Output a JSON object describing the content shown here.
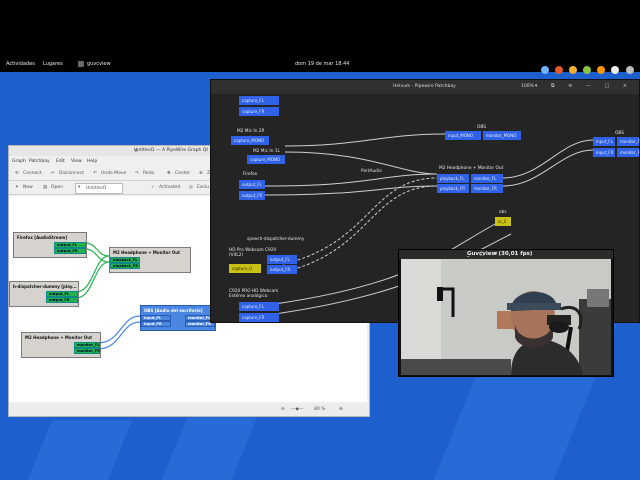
{
  "topbar": {
    "activities": "Actividades",
    "places": "Lugares",
    "app_name": "guvcview",
    "datetime": "dom 19 de mar  18:44"
  },
  "colors": {
    "wallpaper": "#1d5fcc",
    "helvum_port_blue": "#2f62e6",
    "helvum_port_yellow": "#c9c214",
    "qt_port_green": "#22b14c",
    "qt_port_blue": "#4b87e0"
  },
  "left_window": {
    "title": "Untitled1 — A PipeWire Graph Qt",
    "close": "×",
    "menu": [
      "Graph",
      "Patchbay",
      "Edit",
      "View",
      "Help"
    ],
    "toolbar": [
      "Connect",
      "Disconnect",
      "Undo Move",
      "Redo",
      "Center",
      "Zoom"
    ],
    "toolbar2": [
      "New",
      "Open"
    ],
    "combo_value": "Untitled1",
    "toolbar2_right": [
      "Activated",
      "Exclu"
    ],
    "zoom": "80 %",
    "nodes": {
      "firefox": {
        "title": "Firefox [AudioStream]",
        "ports": [
          "output_FL",
          "output_FR"
        ]
      },
      "m2out": {
        "title": "M2 Headphone + Monitor Out",
        "ports": [
          "playback_FL",
          "playback_FR"
        ]
      },
      "dispatcher": {
        "title": "h-dispatcher-dummy [play...",
        "ports": [
          "output_FL",
          "output_FR"
        ]
      },
      "m2mon": {
        "title": "M2 Headphone + Monitor Out",
        "ports": [
          "monitor_FL",
          "monitor_FR"
        ]
      },
      "obs": {
        "title": "OBS [Audio del escritorio]",
        "inputs": [
          "input_FL",
          "input_FR"
        ],
        "outputs": [
          "monitor_FL",
          "monitor_FR"
        ]
      }
    }
  },
  "right_window": {
    "title": "Helvum - Pipewire Patchbay",
    "zoom": "100%",
    "buttons": "▾ ⧉ ≡ — □ ×",
    "nodes": {
      "top_ports": [
        "capture_FL",
        "capture_FR"
      ],
      "m2mic_label": "M2 Mic In 2R",
      "m2mic_ports": [
        "capture_MONO"
      ],
      "m2mic1_label": "M2 Mic In 1L",
      "m2mic1_ports": [
        "capture_MONO"
      ],
      "firefox_label": "Firefox",
      "firefox_ports": [
        "output_FL",
        "output_FR"
      ],
      "portaudio_label": "PortAudio",
      "obs_mid_label": "OBS",
      "obs_mid_ports": [
        "input_MONO",
        "monitor_MONO"
      ],
      "m2out_label": "M2 Headphone + Monitor Out",
      "m2out_ports": [
        "playback_FL",
        "monitor_FL",
        "playback_FR",
        "monitor_FR"
      ],
      "obs_right_label": "OBS",
      "obs_right_ports": [
        "input_FL",
        "monitor_FL",
        "input_FR",
        "monitor_FR"
      ],
      "obs_yellow_label": "obs",
      "obs_yellow_port": "in_0",
      "dispatcher_label": "speech-dispatcher-dummy",
      "hdpro_label": "HD Pro Webcam C920\n(V4L2)",
      "hdpro_ports": [
        "output_FL",
        "output_FR",
        "capture_0"
      ],
      "c920_label": "C920 PRO HD Webcam\nEstéreo analógico",
      "c920_ports": [
        "capture_FL",
        "capture_FR"
      ]
    }
  },
  "cam_window": {
    "title": "Guvcview  (30,01 fps)",
    "buttons": "_ □ ×"
  }
}
